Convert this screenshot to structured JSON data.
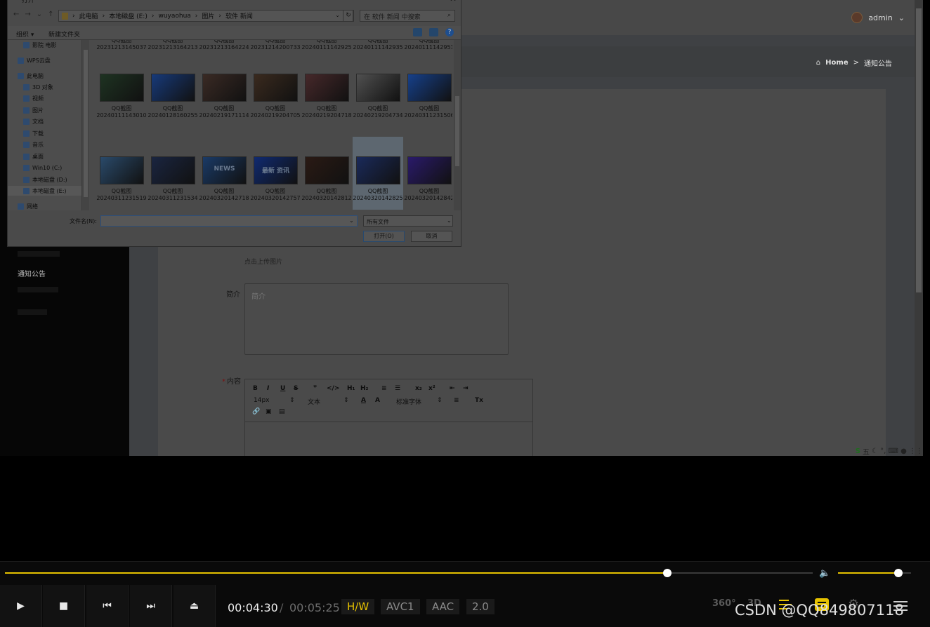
{
  "web_page": {
    "user": "admin",
    "breadcrumb": {
      "home": "Home",
      "separator": ">",
      "current": "通知公告"
    },
    "sidebar": {
      "items": [
        {
          "label": "通知公告",
          "dim": false
        },
        {
          "label": "",
          "dim": true
        },
        {
          "label": "",
          "dim": true
        },
        {
          "label": "",
          "dim": true
        }
      ]
    },
    "form": {
      "upload_hint": "点击上传图片",
      "desc_label": "简介",
      "desc_placeholder": "简介",
      "content_required": "*",
      "content_label": "内容",
      "editor": {
        "bold": "B",
        "italic": "I",
        "underline": "U",
        "strike": "S",
        "quote": "❞",
        "code": "</>",
        "h1": "H₁",
        "h2": "H₂",
        "ordered_list": "≡",
        "bullet_list": "☰",
        "subscript": "x₂",
        "superscript": "x²",
        "outdent": "⇤",
        "indent": "⇥",
        "font_size": "14px",
        "text_type": "文本",
        "text_color": "A",
        "background": "A",
        "font_family": "标准字体",
        "align": "≡",
        "clear": "Tx",
        "link": "🔗",
        "image": "▣",
        "video": "▤"
      }
    },
    "ime": {
      "logo": "S",
      "mode": "五",
      "icons": "☾ °, ⌨ ● ⋮⋮"
    }
  },
  "dialog": {
    "title": "打开",
    "close": "✕",
    "path": [
      "此电脑",
      "本地磁盘 (E:)",
      "wuyaohua",
      "图片",
      "软件 新闻"
    ],
    "search_placeholder": "在 软件 新闻 中搜索",
    "organize": "组织 ▾",
    "new_folder": "新建文件夹",
    "tree": [
      {
        "label": "影院 电影",
        "selected": false
      },
      {
        "label": "WPS云盘",
        "selected": false
      },
      {
        "label": "此电脑",
        "selected": false
      },
      {
        "label": "3D 对象",
        "selected": false
      },
      {
        "label": "视频",
        "selected": false
      },
      {
        "label": "图片",
        "selected": false
      },
      {
        "label": "文档",
        "selected": false
      },
      {
        "label": "下载",
        "selected": false
      },
      {
        "label": "音乐",
        "selected": false
      },
      {
        "label": "桌面",
        "selected": false
      },
      {
        "label": "Win10 (C:)",
        "selected": false
      },
      {
        "label": "本地磁盘 (D:)",
        "selected": false
      },
      {
        "label": "本地磁盘 (E:)",
        "selected": true
      },
      {
        "label": "网络",
        "selected": false
      }
    ],
    "files_top_row": [
      {
        "name": "QQ截图",
        "num": "20231213145037"
      },
      {
        "name": "QQ截图",
        "num": "20231213164213"
      },
      {
        "name": "QQ截图",
        "num": "20231213164224"
      },
      {
        "name": "QQ截图",
        "num": "20231214200733"
      },
      {
        "name": "QQ截图",
        "num": "20240111142925"
      },
      {
        "name": "QQ截图",
        "num": "20240111142935"
      },
      {
        "name": "QQ截图",
        "num": "20240111142951"
      }
    ],
    "files": [
      {
        "name": "QQ截图",
        "num": "20240111143010",
        "color": "#1e3322",
        "selected": false
      },
      {
        "name": "QQ截图",
        "num": "20240128160255",
        "color": "#173a7a",
        "selected": false
      },
      {
        "name": "QQ截图",
        "num": "20240219171114",
        "color": "#3a2a24",
        "selected": false
      },
      {
        "name": "QQ截图",
        "num": "20240219204705",
        "color": "#3a2a1e",
        "selected": false
      },
      {
        "name": "QQ截图",
        "num": "20240219204718",
        "color": "#46282a",
        "selected": false
      },
      {
        "name": "QQ截图",
        "num": "20240219204734",
        "color": "#505050",
        "selected": false
      },
      {
        "name": "QQ截图",
        "num": "20240311231506",
        "color": "#16408a",
        "selected": false
      },
      {
        "name": "QQ截图",
        "num": "20240311231519",
        "color": "#2a4a6a",
        "selected": false
      },
      {
        "name": "QQ截图",
        "num": "20240311231534",
        "color": "#1a2540",
        "selected": false
      },
      {
        "name": "QQ截图",
        "num": "20240320142718",
        "color": "#1a3a66",
        "selected": false
      },
      {
        "name": "QQ截图",
        "num": "20240320142757",
        "color": "#102a70",
        "selected": false
      },
      {
        "name": "QQ截图",
        "num": "20240320142812",
        "color": "#2a1a14",
        "selected": false
      },
      {
        "name": "QQ截图",
        "num": "20240320142825",
        "color": "#1a2a5a",
        "selected": true
      },
      {
        "name": "QQ截图",
        "num": "20240320142842",
        "color": "#2a1a6a",
        "selected": false
      }
    ],
    "thumb_texts": {
      "t10": "NEWS",
      "t11": "最新 资讯"
    },
    "filename_label": "文件名(N):",
    "filename_value": "",
    "filetype": "所有文件",
    "open": "打开(O)",
    "cancel": "取消"
  },
  "player": {
    "current_time": "00:04:30",
    "separator": "/",
    "total_time": "00:05:25",
    "progress": 0.82,
    "volume": 0.83,
    "badges": {
      "hw": "H/W",
      "video_codec": "AVC1",
      "audio_codec": "AAC",
      "channels": "2.0"
    },
    "icons": {
      "play": "▶",
      "stop": "■",
      "prev": "⏮",
      "next": "⏭",
      "eject": "⏏",
      "three_sixty": "360°",
      "three_d": "3D",
      "gear": "⚙"
    },
    "watermark": "CSDN @QQ849807118",
    "accent": "#e6c200"
  }
}
